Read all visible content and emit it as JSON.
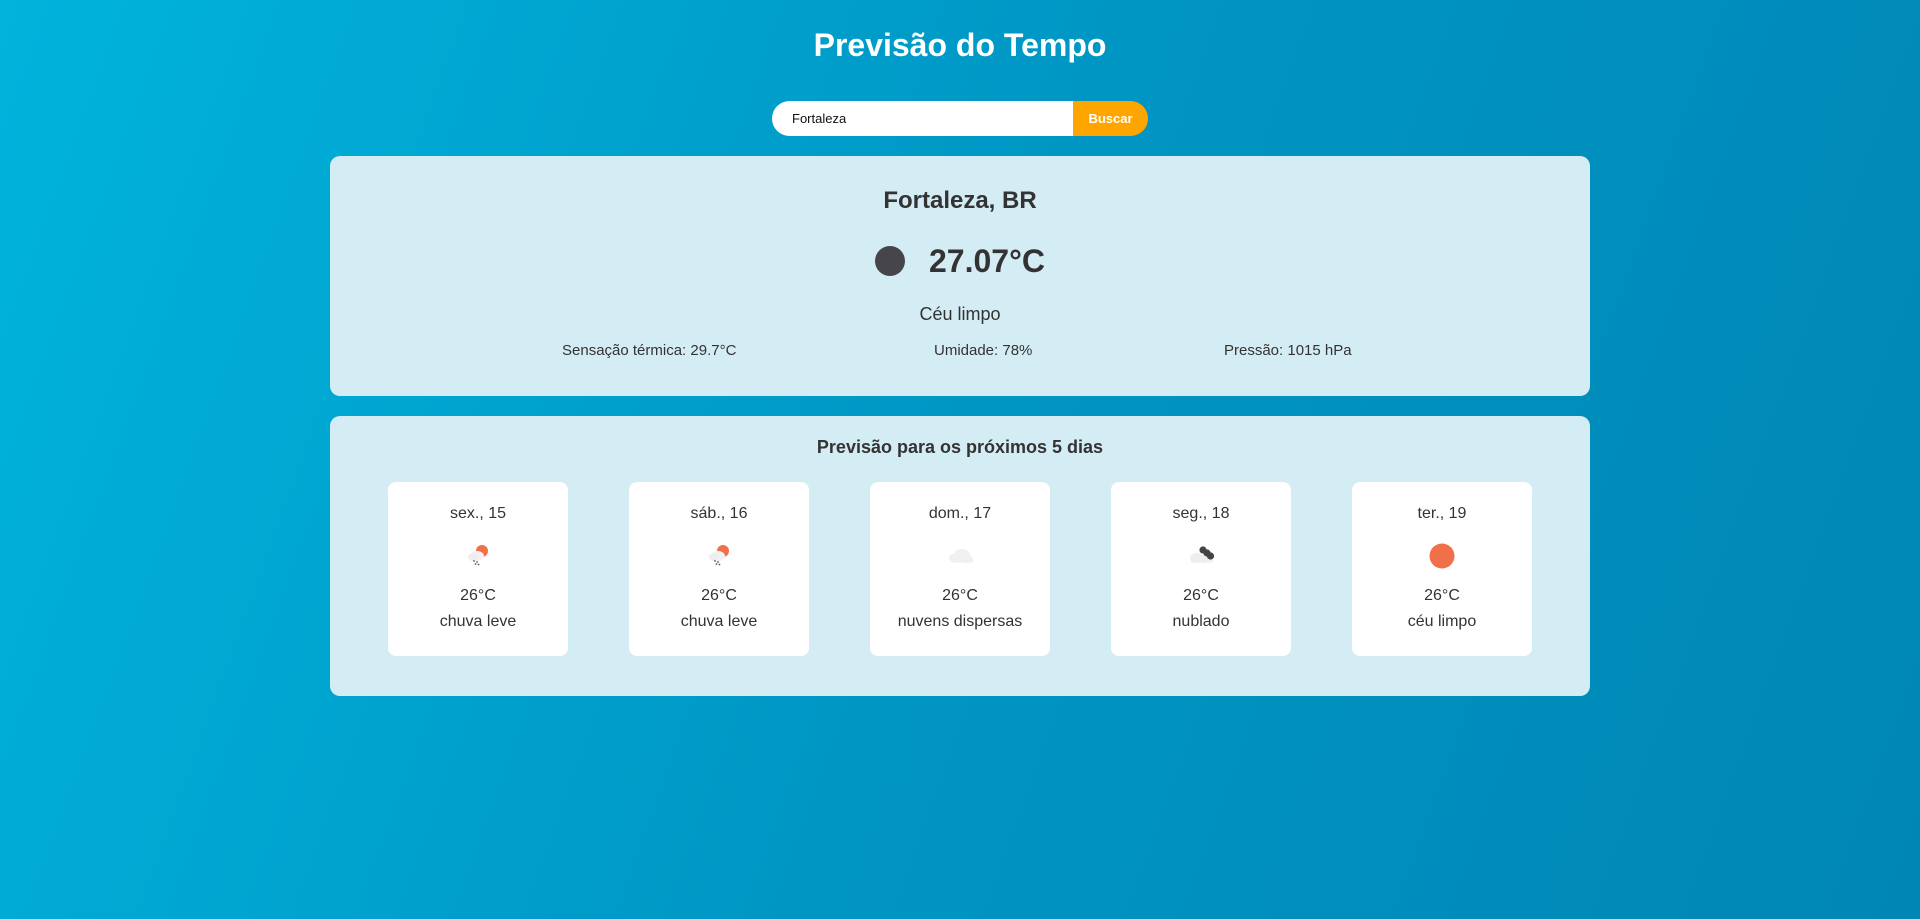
{
  "header": {
    "title": "Previsão do Tempo"
  },
  "search": {
    "value": "Fortaleza",
    "button_label": "Buscar"
  },
  "current": {
    "city": "Fortaleza, BR",
    "icon": "moon-icon",
    "temperature": "27.07°C",
    "description": "Céu limpo",
    "feels_like": "Sensação térmica: 29.7°C",
    "humidity": "Umidade: 78%",
    "pressure": "Pressão: 1015 hPa"
  },
  "forecast": {
    "title": "Previsão para os próximos 5 dias",
    "days": [
      {
        "label": "sex., 15",
        "icon": "light-rain-icon",
        "temp": "26°C",
        "desc": "chuva leve"
      },
      {
        "label": "sáb., 16",
        "icon": "light-rain-icon",
        "temp": "26°C",
        "desc": "chuva leve"
      },
      {
        "label": "dom., 17",
        "icon": "scattered-clouds-icon",
        "temp": "26°C",
        "desc": "nuvens dispersas"
      },
      {
        "label": "seg., 18",
        "icon": "broken-clouds-icon",
        "temp": "26°C",
        "desc": "nublado"
      },
      {
        "label": "ter., 19",
        "icon": "sun-icon",
        "temp": "26°C",
        "desc": "céu limpo"
      }
    ]
  },
  "colors": {
    "accent": "#ffa500",
    "card_background": "#d4ecf3",
    "sun": "#f0704a"
  }
}
